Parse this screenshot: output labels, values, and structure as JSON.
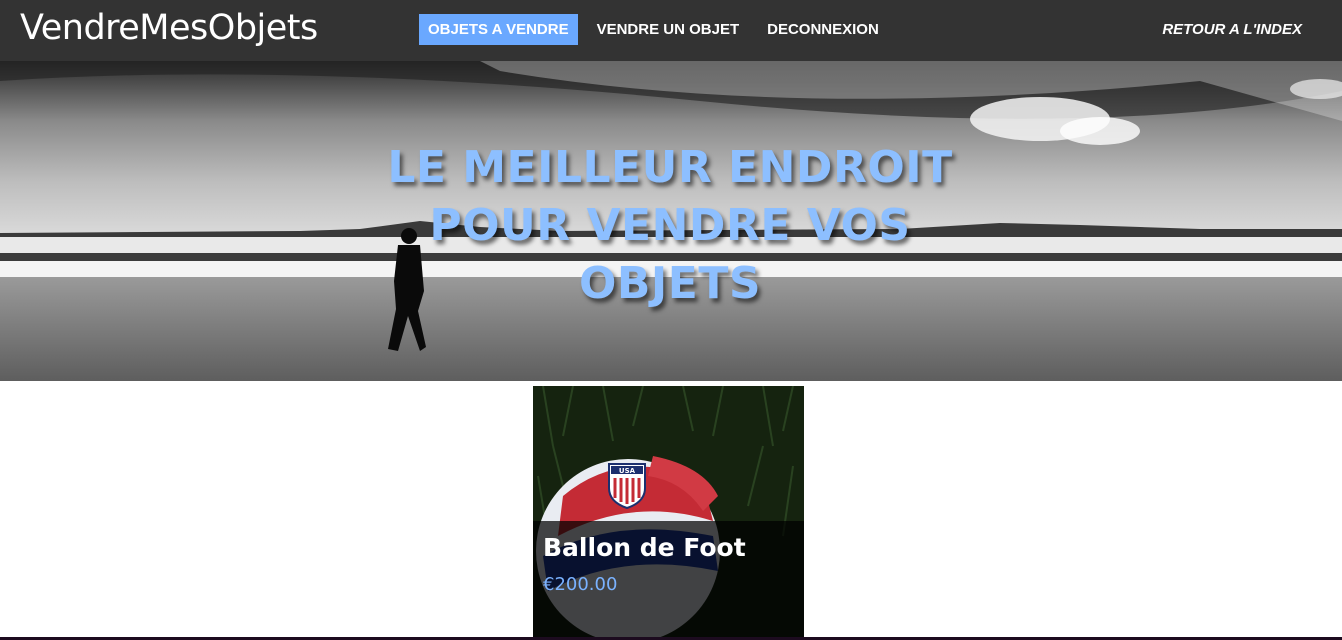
{
  "navbar": {
    "brand": "VendreMesObjets",
    "links": [
      {
        "label": "OBJETS A VENDRE",
        "active": true
      },
      {
        "label": "VENDRE UN OBJET",
        "active": false
      },
      {
        "label": "DECONNEXION",
        "active": false
      }
    ],
    "right_link": "RETOUR A L'INDEX"
  },
  "hero": {
    "title": "LE MEILLEUR ENDROIT POUR VENDRE VOS OBJETS"
  },
  "products": [
    {
      "name": "Ballon de Foot",
      "price": "€200.00",
      "badge": "USA"
    }
  ],
  "colors": {
    "navbar_bg": "#333333",
    "accent": "#6aa8ff",
    "hero_title": "#8dbfff",
    "price": "#7ab2ff"
  }
}
